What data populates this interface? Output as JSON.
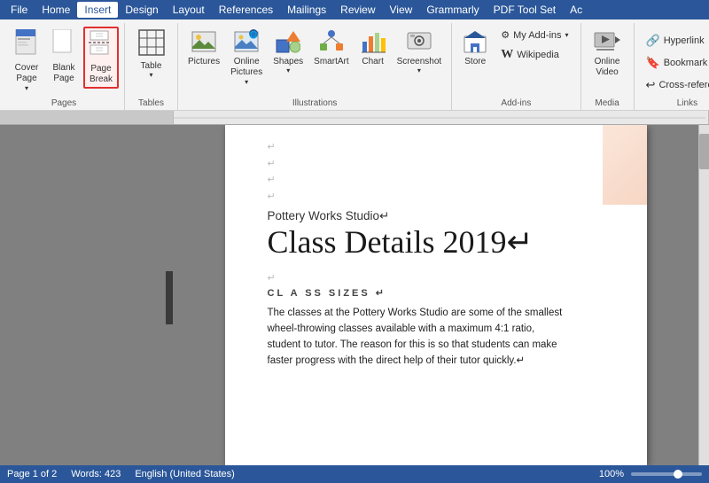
{
  "menubar": {
    "items": [
      "File",
      "Home",
      "Insert",
      "Design",
      "Layout",
      "References",
      "Mailings",
      "Review",
      "View",
      "Grammarly",
      "PDF Tool Set",
      "Ac"
    ]
  },
  "ribbon": {
    "active_tab": "Insert",
    "groups": {
      "pages": {
        "label": "Pages",
        "buttons": [
          {
            "id": "cover-page",
            "icon": "📄",
            "label": "Cover\nPage",
            "dropdown": true
          },
          {
            "id": "blank-page",
            "icon": "📃",
            "label": "Blank\nPage"
          },
          {
            "id": "page-break",
            "icon": "⬛",
            "label": "Page\nBreak",
            "highlighted": true
          }
        ]
      },
      "tables": {
        "label": "Tables",
        "buttons": [
          {
            "id": "table",
            "icon": "⊞",
            "label": "Table",
            "dropdown": true
          }
        ]
      },
      "illustrations": {
        "label": "Illustrations",
        "buttons": [
          {
            "id": "pictures",
            "icon": "🖼",
            "label": "Pictures"
          },
          {
            "id": "online-pictures",
            "icon": "🌐",
            "label": "Online\nPictures",
            "dropdown": true
          },
          {
            "id": "shapes",
            "icon": "△",
            "label": "Shapes",
            "dropdown": true
          },
          {
            "id": "smartart",
            "icon": "⬡",
            "label": "SmartArt"
          },
          {
            "id": "chart",
            "icon": "📊",
            "label": "Chart"
          },
          {
            "id": "screenshot",
            "icon": "📷",
            "label": "Screenshot",
            "dropdown": true
          }
        ]
      },
      "addins": {
        "label": "Add-ins",
        "buttons": [
          {
            "id": "store",
            "icon": "🛍",
            "label": "Store"
          },
          {
            "id": "my-addins",
            "icon": "⚙",
            "label": "My Add-ins",
            "dropdown": true
          },
          {
            "id": "wikipedia",
            "icon": "W",
            "label": "Wikipedia"
          }
        ]
      },
      "media": {
        "label": "Media",
        "buttons": [
          {
            "id": "online-video",
            "icon": "▶",
            "label": "Online\nVideo"
          }
        ]
      },
      "links": {
        "label": "Links",
        "buttons": [
          {
            "id": "hyperlink",
            "label": "Hyperlink"
          },
          {
            "id": "bookmark",
            "label": "Bookmark"
          },
          {
            "id": "cross-reference",
            "label": "Cross-reference"
          }
        ]
      }
    }
  },
  "document": {
    "title_small": "Pottery Works Studio↵",
    "title_large": "Class Details 2019↵",
    "section_label": "CL A SS SIZES ↵",
    "body_text": "The classes at the Pottery Works Studio are some of the smallest wheel-throwing classes available with a maximum 4:1 ratio, student to tutor. The reason for this is so that students can make faster progress with the direct help of their tutor quickly.↵"
  },
  "statusbar": {
    "page_info": "Page 1 of 2",
    "word_count": "Words: 423",
    "language": "English (United States)",
    "zoom": "100%"
  }
}
